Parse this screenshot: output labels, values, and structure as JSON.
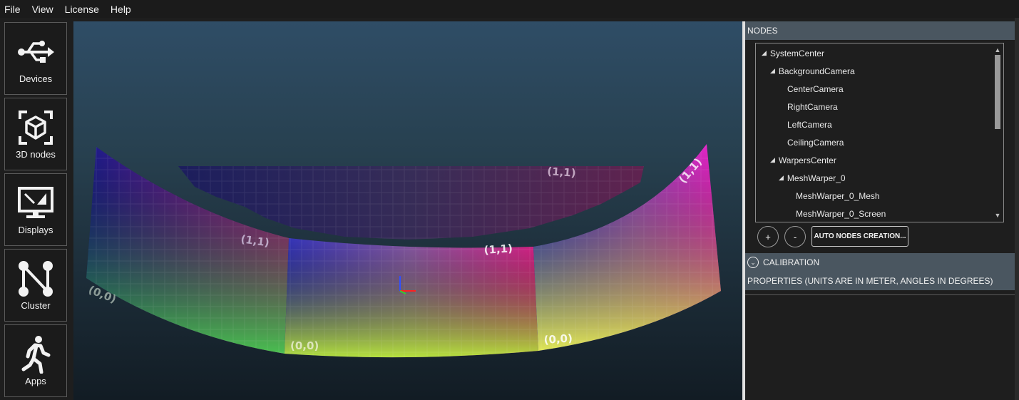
{
  "menu": {
    "items": [
      "File",
      "View",
      "License",
      "Help"
    ]
  },
  "nav": {
    "items": [
      {
        "label": "Devices",
        "icon": "usb-icon"
      },
      {
        "label": "3D nodes",
        "icon": "cube-icon"
      },
      {
        "label": "Displays",
        "icon": "display-icon"
      },
      {
        "label": "Cluster",
        "icon": "cluster-icon"
      },
      {
        "label": "Apps",
        "icon": "walking-person-icon"
      }
    ]
  },
  "viewport": {
    "uv_labels": [
      "(1,1)",
      "(1,1)",
      "(1,1)",
      "(1,1)",
      "(0,0)",
      "(0,0)",
      "(0,0)"
    ]
  },
  "nodes": {
    "header": "NODES",
    "tree": [
      {
        "label": "SystemCenter",
        "expanded": true,
        "level": 0
      },
      {
        "label": "BackgroundCamera",
        "expanded": true,
        "level": 1
      },
      {
        "label": "CenterCamera",
        "level": 2
      },
      {
        "label": "RightCamera",
        "level": 2
      },
      {
        "label": "LeftCamera",
        "level": 2
      },
      {
        "label": "CeilingCamera",
        "level": 2
      },
      {
        "label": "WarpersCenter",
        "expanded": true,
        "level": 1
      },
      {
        "label": "MeshWarper_0",
        "expanded": true,
        "level": 2
      },
      {
        "label": "MeshWarper_0_Mesh",
        "level": 3
      },
      {
        "label": "MeshWarper_0_Screen",
        "level": 3
      }
    ],
    "add_label": "+",
    "remove_label": "-",
    "auto_label": "AUTO NODES CREATION..."
  },
  "calibration": {
    "label": "CALIBRATION"
  },
  "properties": {
    "label": "PROPERTIES (UNITS ARE IN METER, ANGLES IN DEGREES)"
  }
}
